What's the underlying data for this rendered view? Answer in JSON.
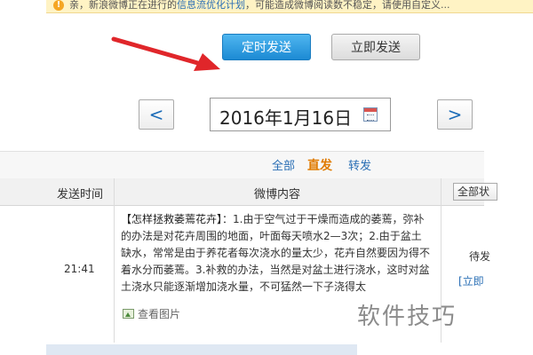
{
  "notice": {
    "icon": "warning-icon",
    "text_prefix": "亲，新浪微博正在进行的",
    "text_link": "信息流优化计划",
    "text_suffix": "，可能造成微博阅读数不稳定，请使用自定义..."
  },
  "actions": {
    "timed_send_label": "定时发送",
    "send_now_label": "立即发送"
  },
  "date_nav": {
    "prev_label": "<",
    "date_value": "2016年1月16日",
    "calendar_icon": "calendar-icon",
    "next_label": ">"
  },
  "filters": {
    "all": "全部",
    "original": "直发",
    "forward": "转发"
  },
  "table": {
    "col_time": "发送时间",
    "col_content": "微博内容",
    "col_select": "全部状"
  },
  "post": {
    "time": "21:41",
    "title": "【怎样拯救萎蔫花卉】",
    "body": "：1.由于空气过于干燥而造成的萎蔫，弥补的办法是对花卉周围的地面，叶面每天喷水2—3次；2.由于盆土缺水，常常是由于养花者每次浇水的量太少，花卉自然要因为得不着水分而萎蔫。3.补救的办法，当然是对盆土进行浇水，这时对盆土浇水只能逐渐增加浇水量，不可猛然一下子浇得太",
    "view_images": "查看图片",
    "status": "待发",
    "send_now_link": "[立即"
  },
  "watermark": "软件技巧",
  "colors": {
    "accent_blue": "#1c8ad4",
    "arrow_red": "#e0262a",
    "filter_active": "#e07a00"
  }
}
